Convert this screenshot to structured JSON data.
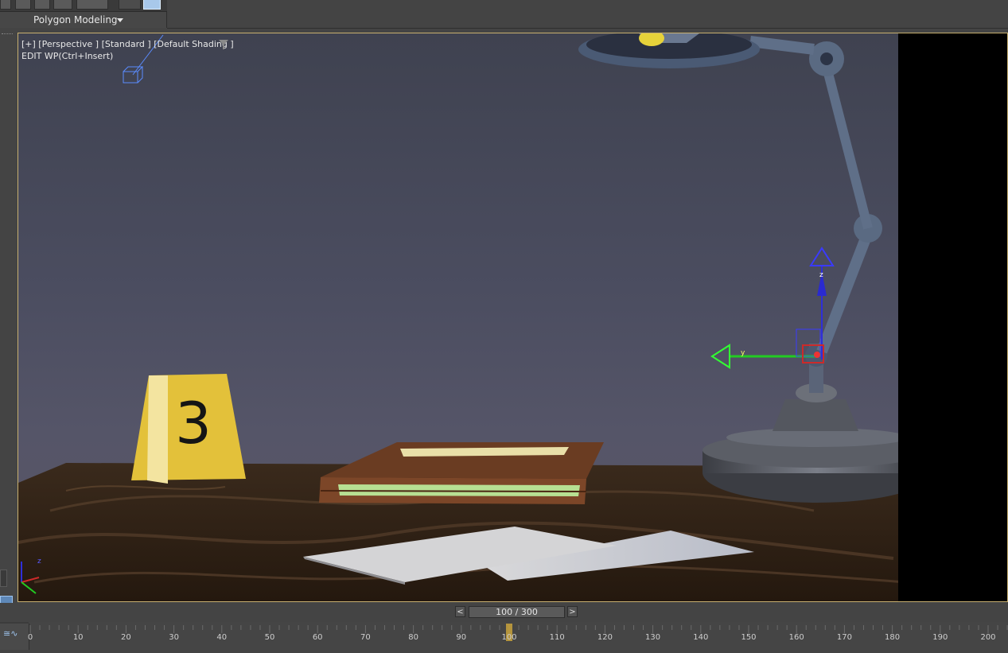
{
  "ribbon": {
    "tab_label": "Polygon Modeling",
    "dropdown_icon": "caret-down-icon"
  },
  "viewport": {
    "label": "[+] [Perspective ] [Standard ] [Default Shading ]",
    "sublabel": "EDIT WP(Ctrl+Insert)",
    "filter_icon": "filter-funnel-icon",
    "gizmo_axes": [
      "z",
      "y"
    ],
    "evidence_marker_number": "3",
    "axis_tripod": [
      "x",
      "y",
      "z"
    ]
  },
  "timeline": {
    "frame_display": "100 / 300",
    "prev_label": "<",
    "next_label": ">",
    "current_frame": 100,
    "total_frames": 300,
    "icon_glyph": "≅∿",
    "ticks": [
      "0",
      "10",
      "20",
      "30",
      "40",
      "50",
      "60",
      "70",
      "80",
      "90",
      "100",
      "110",
      "120",
      "130",
      "140",
      "150",
      "160",
      "170",
      "180",
      "190",
      "200"
    ]
  },
  "colors": {
    "viewport_border": "#c8b070",
    "selection_blue": "#5e88b8",
    "gizmo_z": "#2f2fd8",
    "gizmo_y": "#22cc22",
    "marker_yellow": "#e3c13a"
  }
}
